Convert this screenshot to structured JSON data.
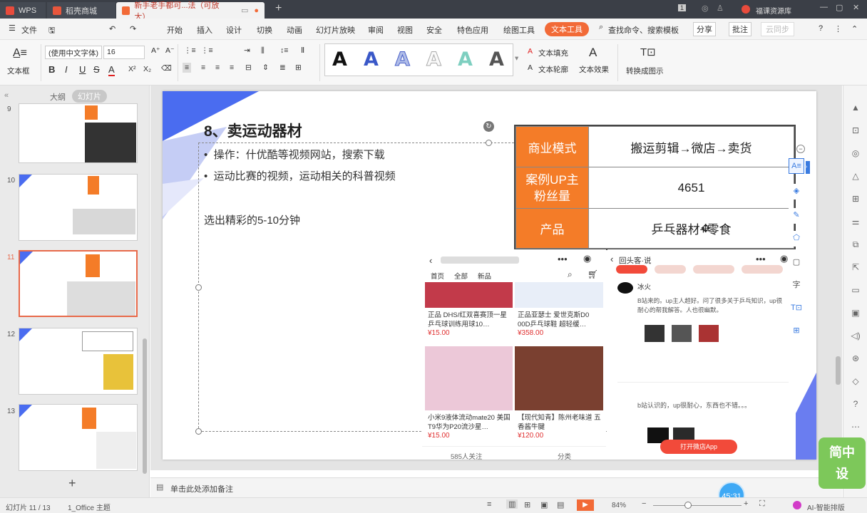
{
  "titlebar": {
    "tabs": [
      {
        "label": "WPS"
      },
      {
        "label": "稻壳商城"
      },
      {
        "label": "新手老手都可...法（可放大）"
      }
    ],
    "account": "福课资源库",
    "page_indicator": "1"
  },
  "menubar": {
    "file": "文件",
    "items": [
      "开始",
      "插入",
      "设计",
      "切换",
      "动画",
      "幻灯片放映",
      "审阅",
      "视图",
      "安全",
      "特色应用",
      "绘图工具",
      "文本工具"
    ],
    "search": "查找命令、搜索模板",
    "share": "分享",
    "comment": "批注",
    "sync": "云同步"
  },
  "ribbon": {
    "textbox": "文本框",
    "font_name": "(使用中文字体)",
    "font_size": "16",
    "bold": "B",
    "italic": "I",
    "underline": "U",
    "strike": "S",
    "color": "A",
    "superscript": "X²",
    "subscript": "X₂",
    "text_fill": "文本填充",
    "text_outline": "文本轮廓",
    "text_effect": "文本效果",
    "convert_smartart": "转换成图示",
    "wordart_sample": "A"
  },
  "left_pane": {
    "outline_tab": "大纲",
    "slides_tab": "幻灯片",
    "numbers": [
      "9",
      "10",
      "11",
      "12",
      "13"
    ],
    "add_slide": "+"
  },
  "slide": {
    "title": "8、卖运动器材",
    "bullets": [
      "操作：什优酷等视频网站，搜索下载",
      "运动比赛的视频，运动相关的科普视频"
    ],
    "note": "选出精彩的5-10分钟",
    "table": [
      {
        "label": "商业模式",
        "value": "搬运剪辑→微店→卖货"
      },
      {
        "label": "案例UP主\n粉丝量",
        "value": "4651"
      },
      {
        "label": "产品",
        "value": "乒乓器材+零食"
      }
    ],
    "shop": {
      "nav": [
        "首页",
        "全部",
        "新品"
      ],
      "products": [
        {
          "title": "正品 DHS/红双喜赛顶一星乒乓球训练用球10…",
          "price": "¥15.00"
        },
        {
          "title": "正品亚瑟士 爱世克斯D0 00D乒乓球鞋 超轻缓…",
          "price": "¥358.00"
        },
        {
          "title": "小米9液体流动mate20 美国T9华为P20流沙星…",
          "price": "¥15.00"
        },
        {
          "title": "【现代知青】陈州老味道 五香酱牛腱",
          "price": "¥120.00"
        }
      ],
      "followers": "585人关注",
      "category": "分类"
    },
    "comments": {
      "header": "回头客·说",
      "user1": "冰火",
      "text1": "B站来的。up主人超好。问了很多关于乒乓知识，up很耐心的帮我解答。人也很幽默。",
      "text2": "b站认识的，up很耐心，东西也不错。。。",
      "open_btn": "打开微店App"
    }
  },
  "notes": {
    "placeholder": "单击此处添加备注"
  },
  "status": {
    "slide_pos": "幻灯片 11 / 13",
    "theme": "1_Office 主题",
    "zoom": "84%",
    "ai": "AI-智能排版",
    "timer": "45:31",
    "watermark": "简中设"
  },
  "colors": {
    "accent": "#f26a37",
    "table_label": "#f47c28",
    "slide_blue": "#4a6cf0"
  }
}
